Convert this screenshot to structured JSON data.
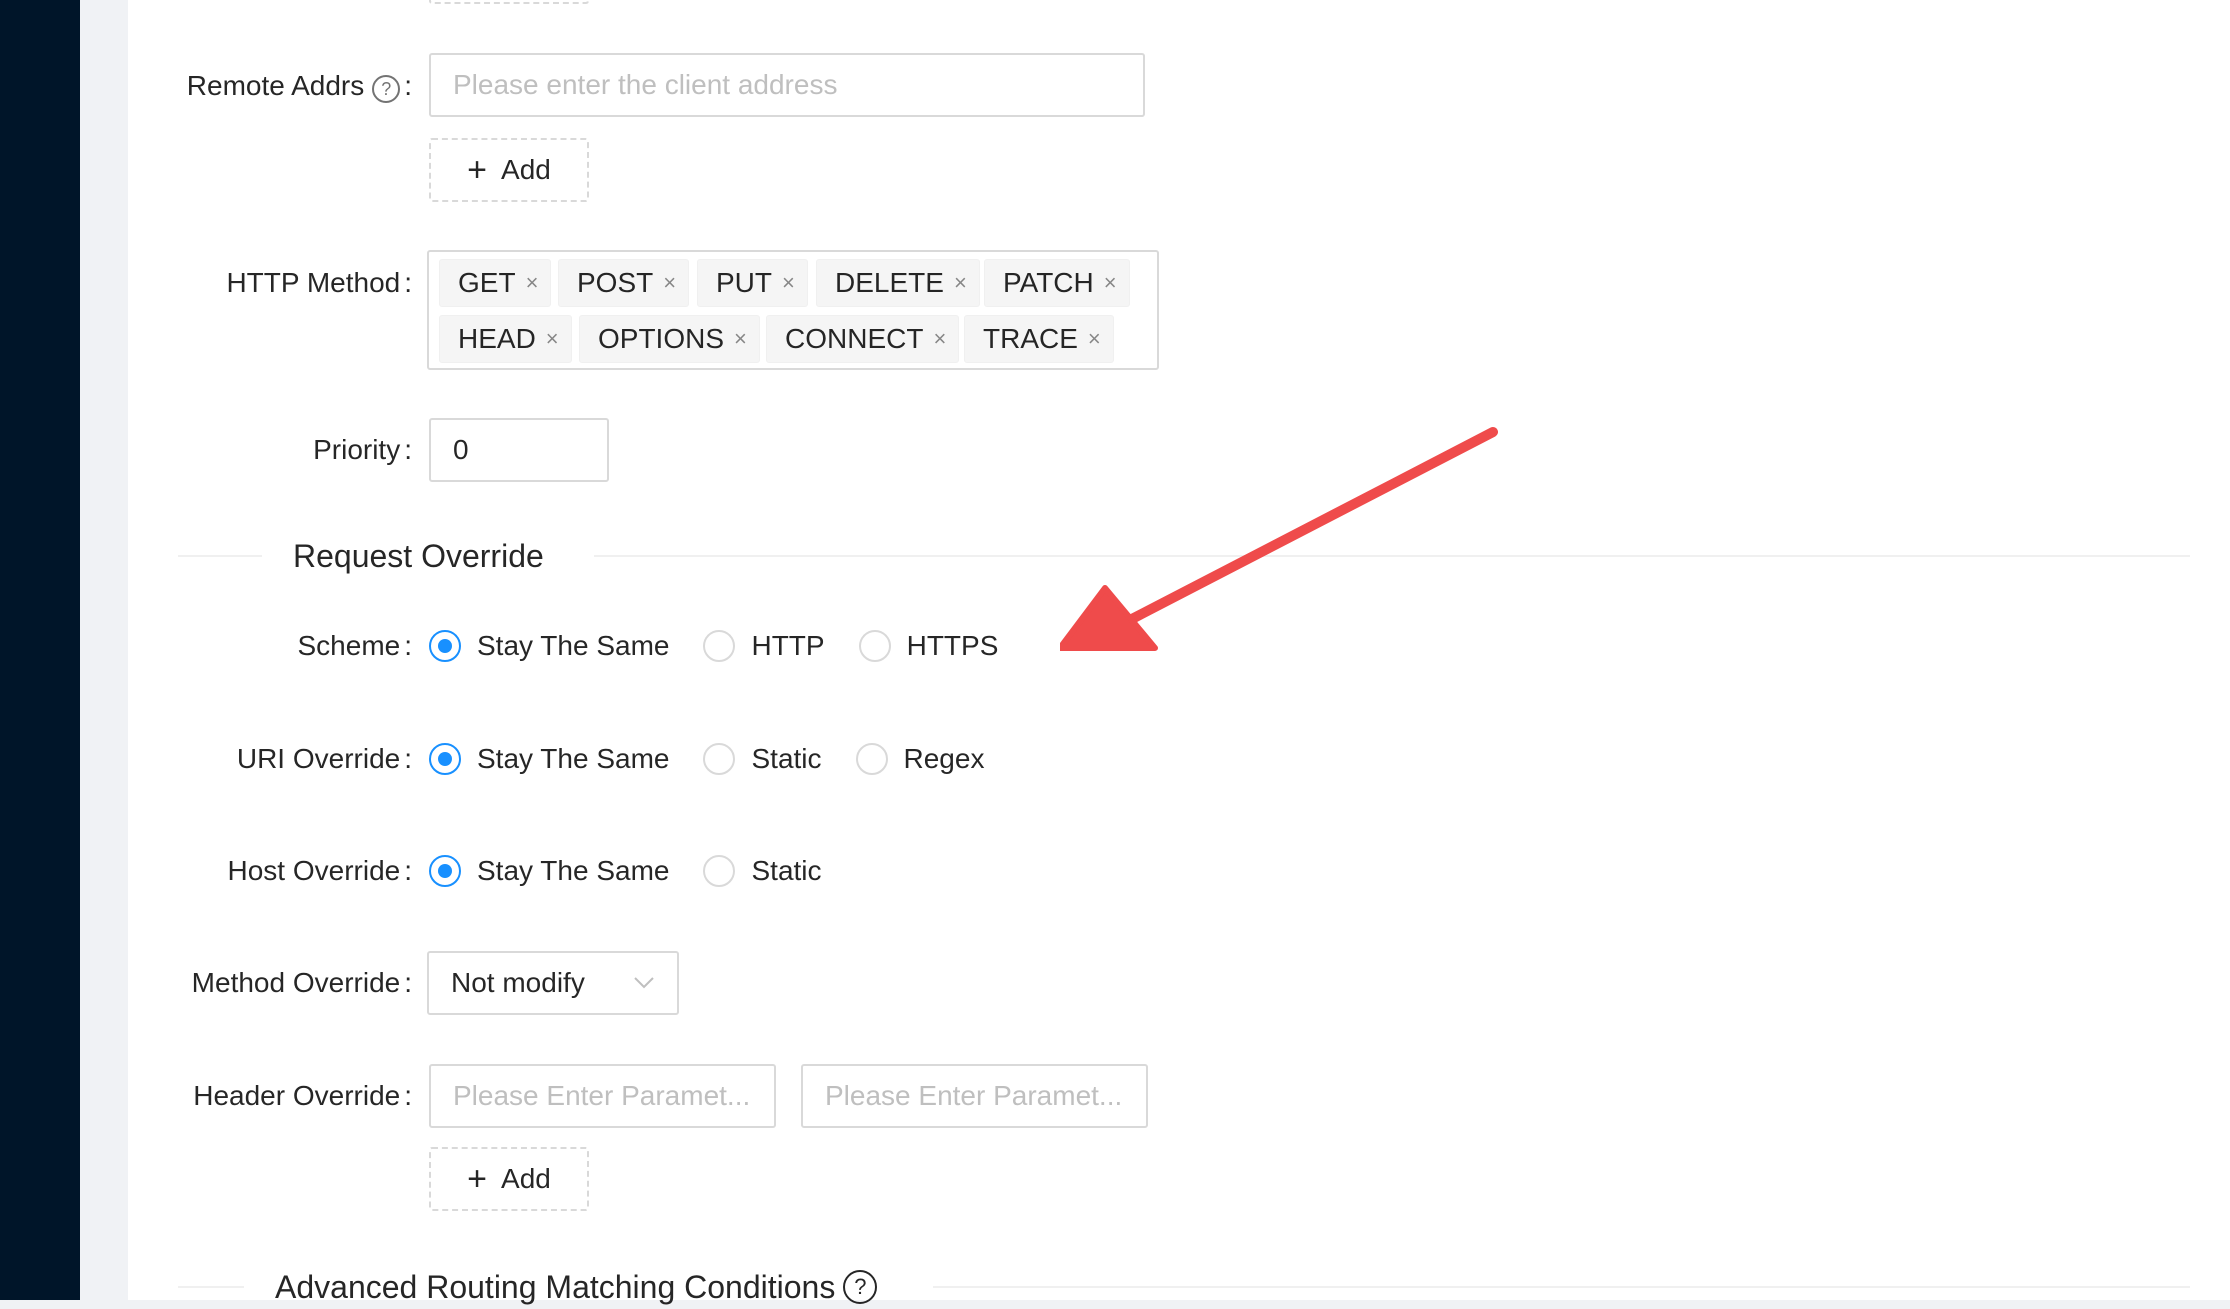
{
  "form": {
    "remote_addrs": {
      "label": "Remote Addrs",
      "placeholder": "Please enter the client address",
      "add_label": "Add"
    },
    "http_method": {
      "label": "HTTP Method",
      "tags": [
        "GET",
        "POST",
        "PUT",
        "DELETE",
        "PATCH",
        "HEAD",
        "OPTIONS",
        "CONNECT",
        "TRACE"
      ]
    },
    "priority": {
      "label": "Priority",
      "value": "0"
    }
  },
  "request_override": {
    "title": "Request Override",
    "scheme": {
      "label": "Scheme",
      "options": [
        "Stay The Same",
        "HTTP",
        "HTTPS"
      ],
      "selected": "Stay The Same"
    },
    "uri_override": {
      "label": "URI Override",
      "options": [
        "Stay The Same",
        "Static",
        "Regex"
      ],
      "selected": "Stay The Same"
    },
    "host_override": {
      "label": "Host Override",
      "options": [
        "Stay The Same",
        "Static"
      ],
      "selected": "Stay The Same"
    },
    "method_override": {
      "label": "Method Override",
      "value": "Not modify"
    },
    "header_override": {
      "label": "Header Override",
      "key_placeholder": "Please Enter Paramet...",
      "value_placeholder": "Please Enter Paramet...",
      "add_label": "Add"
    }
  },
  "advanced": {
    "title": "Advanced Routing Matching Conditions"
  },
  "colors": {
    "sidebar": "#001529",
    "primary": "#1890ff",
    "annotation_arrow": "#ef4b4b"
  },
  "icons": {
    "help": "question-circle-icon",
    "plus": "plus-icon",
    "close": "close-icon",
    "chevron": "chevron-down-icon"
  },
  "separator": ":",
  "glyphs": {
    "plus": "+",
    "close": "×",
    "help": "?"
  }
}
